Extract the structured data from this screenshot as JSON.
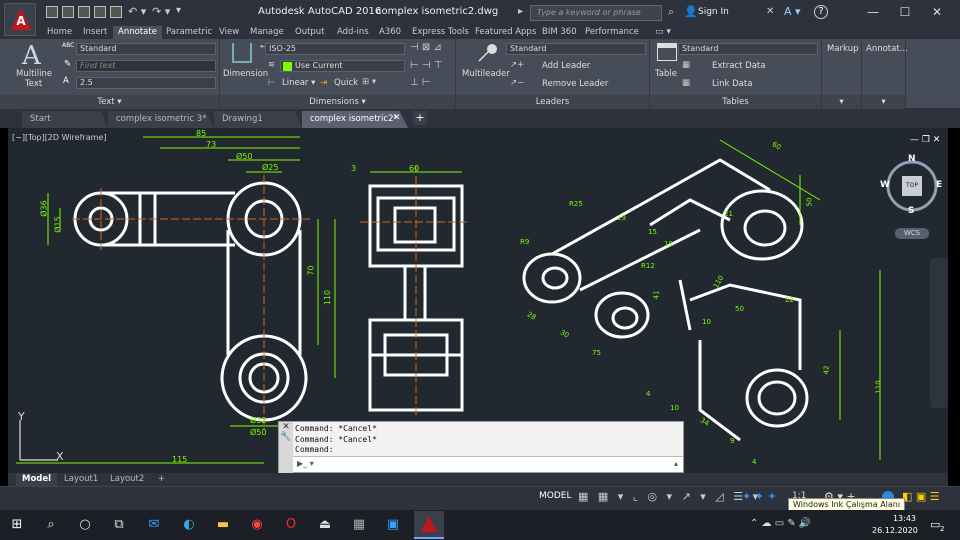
{
  "app": {
    "title": "Autodesk AutoCAD 2016",
    "file": "complex isometric2.dwg",
    "search_placeholder": "Type a keyword or phrase",
    "signin": "Sign In",
    "logo_letter": "A"
  },
  "ribbon_tabs": [
    "Home",
    "Insert",
    "Annotate",
    "Parametric",
    "View",
    "Manage",
    "Output",
    "Add-ins",
    "A360",
    "Express Tools",
    "Featured Apps",
    "BIM 360",
    "Performance"
  ],
  "active_ribbon_tab": "Annotate",
  "panels": {
    "text": {
      "title": "Text",
      "big_label1": "Multiline",
      "big_label2": "Text",
      "style": "Standard",
      "find_placeholder": "Find text",
      "height": "2.5",
      "style_icon": "ABC"
    },
    "dimensions": {
      "title": "Dimensions",
      "big_label": "Dimension",
      "style": "ISO-25",
      "layer": "Use Current",
      "linear": "Linear",
      "quick": "Quick"
    },
    "leaders": {
      "title": "Leaders",
      "big_label": "Multileader",
      "style": "Standard",
      "add": "Add Leader",
      "remove": "Remove Leader"
    },
    "tables": {
      "title": "Tables",
      "big_label": "Table",
      "style": "Standard",
      "extract": "Extract Data",
      "link": "Link Data"
    },
    "markup": {
      "title": "Markup"
    },
    "annotation": {
      "title": "Annotat..."
    }
  },
  "doc_tabs": [
    {
      "label": "Start",
      "active": false
    },
    {
      "label": "complex isometric 3*",
      "active": false
    },
    {
      "label": "Drawing1",
      "active": false
    },
    {
      "label": "complex isometric2*",
      "active": true
    }
  ],
  "viewport_label": "[−][Top][2D Wireframe]",
  "command": {
    "history": [
      "Command: *Cancel*",
      "Command: *Cancel*",
      "Command:"
    ]
  },
  "layout_tabs": [
    "Model",
    "Layout1",
    "Layout2"
  ],
  "status": {
    "model": "MODEL",
    "scale": "1:1"
  },
  "navcube": {
    "n": "N",
    "s": "S",
    "e": "E",
    "w": "W",
    "face": "TOP",
    "wcs": "WCS"
  },
  "ucs": {
    "x": "X",
    "y": "Y"
  },
  "tooltip": "Windows Ink Çalışma Alanı",
  "clock": {
    "time": "13:43",
    "date": "26.12.2020",
    "badge": "2"
  },
  "colors": {
    "canvas": "#212830",
    "geometry": "#ffffff",
    "dimension": "#7cfc00",
    "center": "#d2691e",
    "accent": "#2b8ad6"
  },
  "dims_front": [
    "85",
    "73",
    "Ø50",
    "Ø25",
    "Ø36",
    "Ø15",
    "70",
    "110",
    "Ø32",
    "Ø50",
    "115"
  ],
  "dims_side": [
    "3",
    "60"
  ],
  "dims_iso": [
    "60",
    "R25",
    "21",
    "50",
    "R9",
    "19",
    "19",
    "15",
    "41",
    "R12",
    "110",
    "10",
    "30",
    "22",
    "50",
    "75",
    "28",
    "42",
    "110",
    "4",
    "34",
    "10",
    "9",
    "4"
  ]
}
